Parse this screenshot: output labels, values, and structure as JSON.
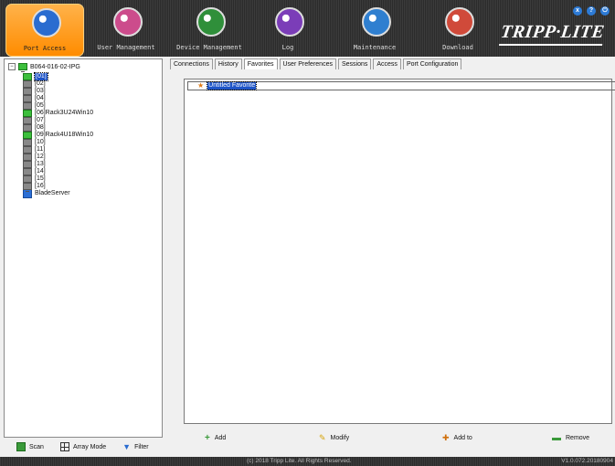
{
  "nav": [
    {
      "label": "Port Access",
      "color": "#2a6cd0",
      "active": true
    },
    {
      "label": "User Management",
      "color": "#cc4c8c",
      "active": false
    },
    {
      "label": "Device Management",
      "color": "#2f8f3a",
      "active": false
    },
    {
      "label": "Log",
      "color": "#7b3db8",
      "active": false
    },
    {
      "label": "Maintenance",
      "color": "#2f7fd0",
      "active": false
    },
    {
      "label": "Download",
      "color": "#d04a3a",
      "active": false
    }
  ],
  "window_buttons": [
    "close",
    "help",
    "logout"
  ],
  "brand": "TRIPP·LITE",
  "tree": {
    "root": "B064-016-02-IPG",
    "items": [
      {
        "label": "[01]",
        "on": true,
        "selected": true
      },
      {
        "label": "[02]",
        "on": false
      },
      {
        "label": "[03]",
        "on": false
      },
      {
        "label": "[04]",
        "on": false
      },
      {
        "label": "[05]",
        "on": false
      },
      {
        "label": "[06]Rack3U24Win10",
        "on": true
      },
      {
        "label": "[07]",
        "on": false
      },
      {
        "label": "[08]",
        "on": false
      },
      {
        "label": "[09]Rack4U18Win10",
        "on": true
      },
      {
        "label": "[10]",
        "on": false
      },
      {
        "label": "[11]",
        "on": false
      },
      {
        "label": "[12]",
        "on": false
      },
      {
        "label": "[13]",
        "on": false
      },
      {
        "label": "[14]",
        "on": false
      },
      {
        "label": "[15]",
        "on": false
      },
      {
        "label": "[16]",
        "on": false
      },
      {
        "label": "BladeServer",
        "blade": true
      }
    ]
  },
  "tabs": [
    "Connections",
    "History",
    "Favorites",
    "User Preferences",
    "Sessions",
    "Access",
    "Port Configuration"
  ],
  "active_tab": "Favorites",
  "favorites": [
    "Untitled Favorite"
  ],
  "actions": [
    "Add",
    "Modify",
    "Add to",
    "Remove"
  ],
  "bottom_left": [
    "Scan",
    "Array Mode",
    "Filter"
  ],
  "status": {
    "copyright": "(c) 2018 Tripp Lite. All Rights Reserved.",
    "version": "V1.0.072.20180904"
  }
}
